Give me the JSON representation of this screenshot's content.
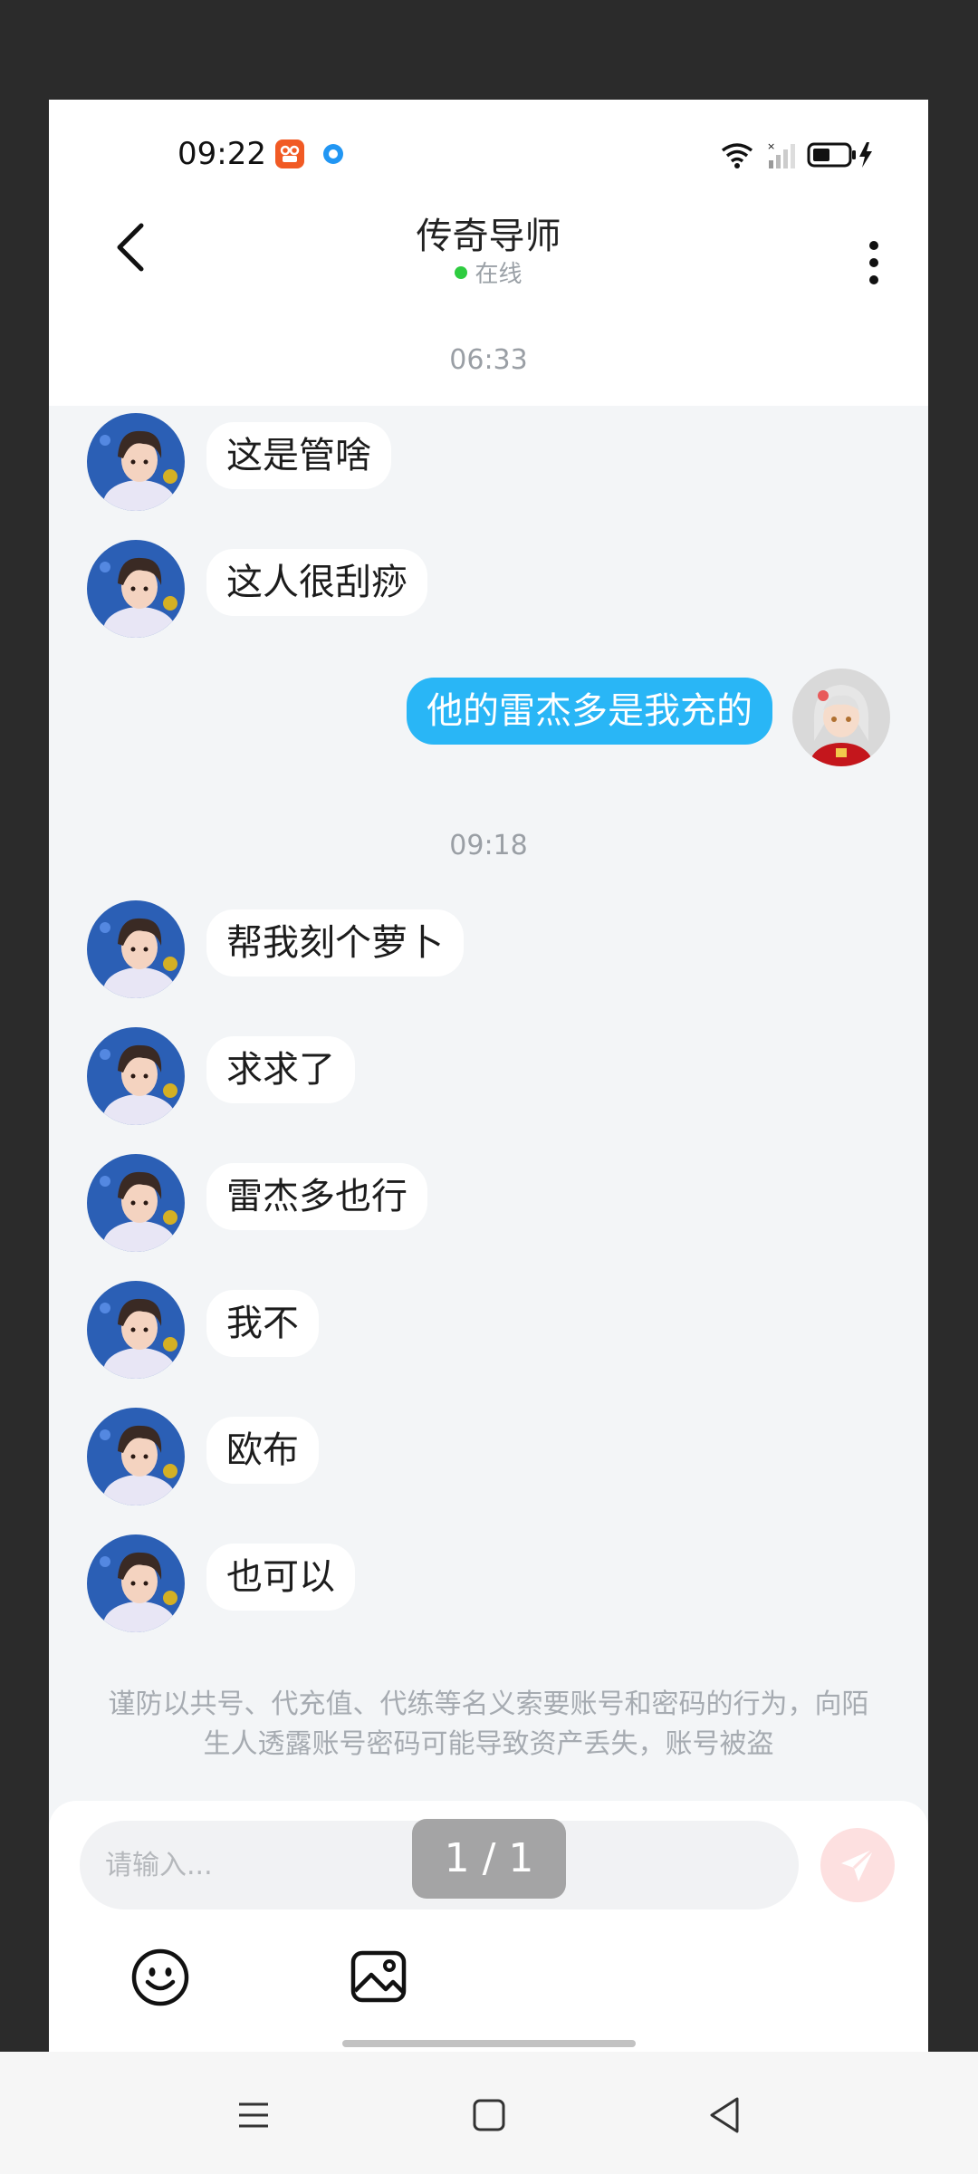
{
  "status_bar": {
    "time": "09:22"
  },
  "header": {
    "title": "传奇导师",
    "status": "在线"
  },
  "chat": {
    "timestamp_1": "06:33",
    "timestamp_2": "09:18",
    "messages": [
      {
        "side": "left",
        "text": "这是管啥"
      },
      {
        "side": "left",
        "text": "这人很刮痧"
      },
      {
        "side": "right",
        "text": "他的雷杰多是我充的"
      },
      {
        "side": "left",
        "text": "帮我刻个萝卜"
      },
      {
        "side": "left",
        "text": "求求了"
      },
      {
        "side": "left",
        "text": "雷杰多也行"
      },
      {
        "side": "left",
        "text": "我不"
      },
      {
        "side": "left",
        "text": "欧布"
      },
      {
        "side": "left",
        "text": "也可以"
      }
    ],
    "warning": "谨防以共号、代充值、代练等名义索要账号和密码的行为，向陌生人透露账号密码可能导致资产丢失，账号被盗"
  },
  "input": {
    "placeholder": "请输入..."
  },
  "page_indicator": "1 / 1",
  "icons": {
    "back": "chevron-left-icon",
    "more": "more-vertical-icon",
    "send": "send-icon",
    "emoji": "emoji-icon",
    "image": "image-icon"
  },
  "colors": {
    "accent_bubble": "#29b6f6",
    "send_button_bg": "#fde0e0",
    "online_dot": "#2ecc40"
  }
}
